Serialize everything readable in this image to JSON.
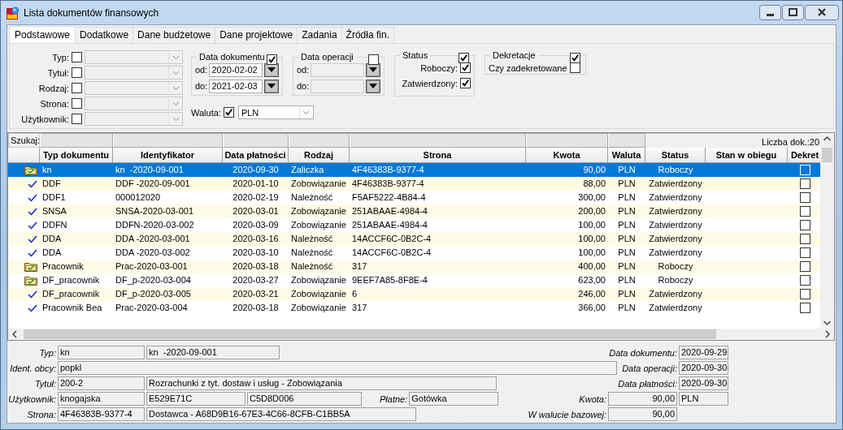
{
  "window": {
    "title": "Lista dokumentów finansowych"
  },
  "tabs": [
    {
      "label": "Podstawowe",
      "selected": true
    },
    {
      "label": "Dodatkowe",
      "selected": false
    },
    {
      "label": "Dane budżetowe",
      "selected": false
    },
    {
      "label": "Dane projektowe",
      "selected": false
    },
    {
      "label": "Zadania",
      "selected": false
    },
    {
      "label": "Źródła fin.",
      "selected": false
    }
  ],
  "filters": {
    "rows": [
      {
        "label": "Typ:",
        "checked": false
      },
      {
        "label": "Tytuł:",
        "checked": false
      },
      {
        "label": "Rodzaj:",
        "checked": false
      },
      {
        "label": "Strona:",
        "checked": false
      },
      {
        "label": "Użytkownik:",
        "checked": false
      }
    ],
    "date_groups": [
      {
        "title": "Data dokumentu",
        "checked": true,
        "from_label": "od:",
        "from": "2020-02-02",
        "to_label": "do:",
        "to": "2021-02-03"
      },
      {
        "title": "Data operacji",
        "checked": false,
        "from_label": "od:",
        "to_label": "do:"
      }
    ],
    "currency": {
      "label": "Waluta:",
      "checked": true,
      "value": "PLN"
    },
    "status": {
      "title": "Status",
      "checked": true,
      "options": [
        {
          "label": "Roboczy:",
          "checked": true
        },
        {
          "label": "Zatwierdzony:",
          "checked": true
        }
      ]
    },
    "posting": {
      "title": "Dekretacje",
      "checked": true,
      "options": [
        {
          "label": "Czy zadekretowane",
          "checked": false
        }
      ]
    }
  },
  "table": {
    "search_label": "Szukaj:",
    "count": "Liczba dok.:20",
    "columns": [
      "Typ dokumentu",
      "Identyfikator",
      "Data płatności",
      "Rodzaj",
      "Strona",
      "Kwota",
      "Waluta",
      "Status",
      "Stan w obiegu",
      "Dekret"
    ],
    "rows": [
      {
        "kind": "folder",
        "selected": true,
        "cells": [
          "kn",
          "kn  -2020-09-001",
          "2020-09-30",
          "Zaliczka",
          "4F46383B-9377-4",
          "90,00",
          "PLN",
          "Roboczy"
        ],
        "posted": false
      },
      {
        "kind": "check",
        "selected": false,
        "cells": [
          "DDF",
          "DDF -2020-09-001",
          "2020-01-10",
          "Zobowiązanie",
          "4F46383B-9377-4",
          "88,00",
          "PLN",
          "Zatwierdzony"
        ],
        "posted": false
      },
      {
        "kind": "check",
        "selected": false,
        "cells": [
          "DDF1",
          "000012020",
          "2020-02-19",
          "Należność",
          "F5AF5222-4B84-4",
          "300,00",
          "PLN",
          "Zatwierdzony"
        ],
        "posted": false
      },
      {
        "kind": "check",
        "selected": false,
        "cells": [
          "SNSA",
          "SNSA-2020-03-001",
          "2020-03-01",
          "Zobowiązanie",
          "251ABAAE-4984-4",
          "200,00",
          "PLN",
          "Zatwierdzony"
        ],
        "posted": false
      },
      {
        "kind": "check",
        "selected": false,
        "cells": [
          "DDFN",
          "DDFN-2020-03-002",
          "2020-03-09",
          "Zobowiązanie",
          "251ABAAE-4984-4",
          "100,00",
          "PLN",
          "Zatwierdzony"
        ],
        "posted": false
      },
      {
        "kind": "check",
        "selected": false,
        "cells": [
          "DDA",
          "DDA -2020-03-001",
          "2020-03-16",
          "Należność",
          "14ACCF6C-0B2C-4",
          "100,00",
          "PLN",
          "Zatwierdzony"
        ],
        "posted": false
      },
      {
        "kind": "check",
        "selected": false,
        "cells": [
          "DDA",
          "DDA -2020-03-002",
          "2020-03-10",
          "Należność",
          "14ACCF6C-0B2C-4",
          "100,00",
          "PLN",
          "Zatwierdzony"
        ],
        "posted": false
      },
      {
        "kind": "folder",
        "selected": false,
        "cells": [
          "Pracownik",
          "Prac-2020-03-001",
          "2020-03-18",
          "Należność",
          "317",
          "400,00",
          "PLN",
          "Roboczy"
        ],
        "posted": false
      },
      {
        "kind": "folder",
        "selected": false,
        "cells": [
          "DF_pracownik",
          "DF_p-2020-03-004",
          "2020-03-27",
          "Zobowiązanie",
          "9EEF7A85-8F8E-4",
          "623,00",
          "PLN",
          "Roboczy"
        ],
        "posted": false
      },
      {
        "kind": "check",
        "selected": false,
        "cells": [
          "DF_pracownik",
          "DF_p-2020-03-005",
          "2020-03-21",
          "Zobowiązanie",
          "6",
          "246,00",
          "PLN",
          "Zatwierdzony"
        ],
        "posted": false
      },
      {
        "kind": "check",
        "selected": false,
        "cells": [
          "Pracownik Bea",
          "Prac-2020-03-004",
          "2020-03-18",
          "Zobowiązanie",
          "317",
          "366,00",
          "PLN",
          "Zatwierdzony"
        ],
        "posted": false
      }
    ]
  },
  "details": [
    {
      "label": "Typ:",
      "fields": [
        "kn",
        "kn  -2020-09-001"
      ],
      "right_label": "Data dokumentu:",
      "right_fields": [
        "2020-09-29"
      ]
    },
    {
      "label": "Ident. obcy:",
      "fields": [
        "popkl"
      ],
      "right_label": "Data operacji:",
      "right_fields": [
        "2020-09-30"
      ]
    },
    {
      "label": "Tytuł:",
      "fields": [
        "200-2",
        "Rozrachunki z tyt. dostaw i usług - Zobowiązania"
      ],
      "right_label": "Data płatności:",
      "right_fields": [
        "2020-09-30"
      ]
    },
    {
      "label": "Użytkownik:",
      "fields": [
        "knogajska",
        "E529E71C",
        "C5D8D006"
      ],
      "mid_label": "Płatne:",
      "mid_fields": [
        "Gotówka"
      ],
      "right_label": "Kwota:",
      "right_fields": [
        "90,00",
        "PLN"
      ]
    },
    {
      "label": "Strona:",
      "fields": [
        "4F46383B-9377-4",
        "Dostawca - A68D9B16-67E3-4C66-8CFB-C1BB5A"
      ],
      "right_label": "W walucie bazowej:",
      "right_fields": [
        "90,00"
      ]
    }
  ]
}
